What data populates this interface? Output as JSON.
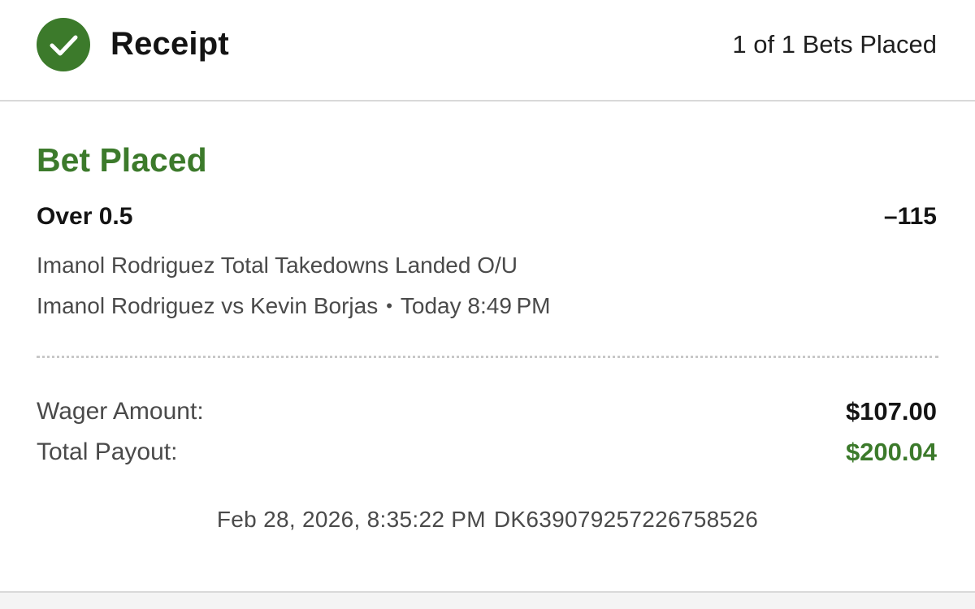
{
  "header": {
    "title": "Receipt",
    "bets_count": "1 of 1 Bets Placed",
    "status_icon": "check-circle-icon"
  },
  "bet": {
    "status": "Bet Placed",
    "selection": "Over 0.5",
    "odds": "–115",
    "market": "Imanol Rodriguez Total Takedowns Landed O/U",
    "event": "Imanol Rodriguez vs Kevin Borjas",
    "separator": "•",
    "event_time": "Today 8:49 PM"
  },
  "amounts": {
    "wager_label": "Wager Amount:",
    "wager_value": "$107.00",
    "payout_label": "Total Payout:",
    "payout_value": "$200.04"
  },
  "footer": {
    "timestamp": "Feb 28, 2026, 8:35:22 PM",
    "bet_id": "DK639079257226758526"
  },
  "colors": {
    "accent_green": "#3c7a2b",
    "text_dark": "#141414",
    "text_muted": "#4a4a4a",
    "divider": "#d9d9d9"
  }
}
